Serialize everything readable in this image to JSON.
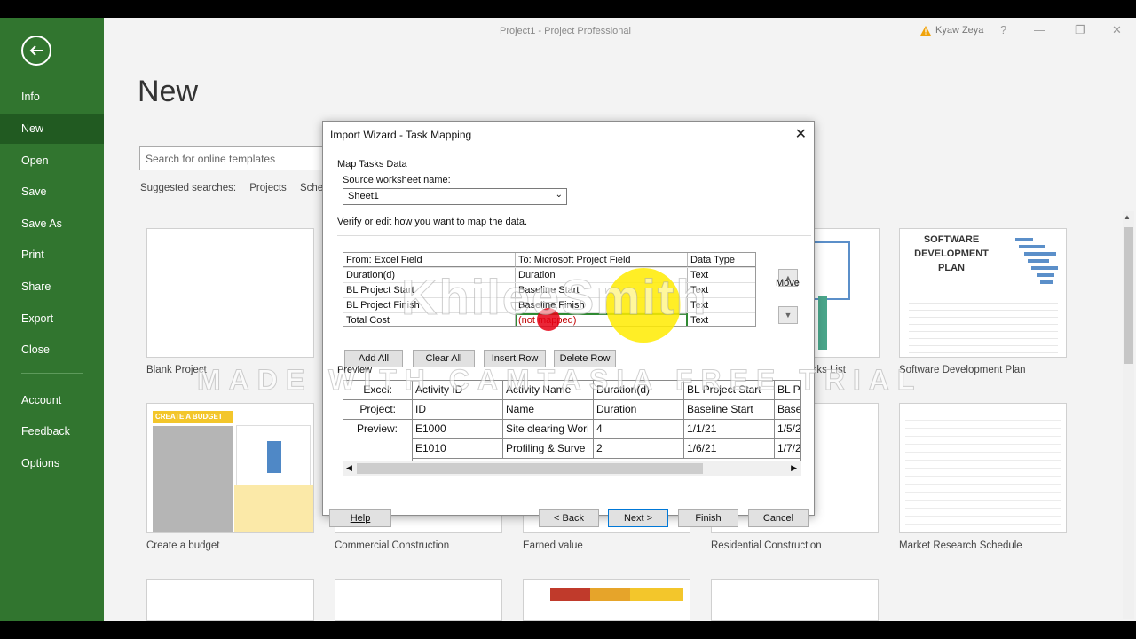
{
  "app": {
    "title": "Project1  -  Project Professional",
    "user": "Kyaw Zeya"
  },
  "sidebar": {
    "items": [
      {
        "label": "Info"
      },
      {
        "label": "New"
      },
      {
        "label": "Open"
      },
      {
        "label": "Save"
      },
      {
        "label": "Save As"
      },
      {
        "label": "Print"
      },
      {
        "label": "Share"
      },
      {
        "label": "Export"
      },
      {
        "label": "Close"
      },
      {
        "label": "Account"
      },
      {
        "label": "Feedback"
      },
      {
        "label": "Options"
      }
    ],
    "active": "New"
  },
  "main": {
    "title": "New",
    "search_placeholder": "Search for online templates",
    "suggested_label": "Suggested searches:",
    "suggested": [
      "Projects",
      "Schedu"
    ],
    "templates": [
      {
        "label": "Blank Project"
      },
      {
        "label": "...sks List"
      },
      {
        "label": "Software Development Plan"
      },
      {
        "label": "Create a budget"
      },
      {
        "label": "Commercial Construction"
      },
      {
        "label": "Earned value"
      },
      {
        "label": "Residential Construction"
      },
      {
        "label": "Market Research Schedule"
      }
    ],
    "budget_thumb_title": "CREATE A BUDGET",
    "sw_thumb_title": "SOFTWARE DEVELOPMENT PLAN"
  },
  "dialog": {
    "title": "Import Wizard - Task Mapping",
    "section": "Map Tasks Data",
    "source_label": "Source worksheet name:",
    "source_value": "Sheet1",
    "verify_text": "Verify or edit how you want to map the data.",
    "mapping": {
      "headers": [
        "From: Excel Field",
        "To:  Microsoft Project Field",
        "Data Type"
      ],
      "rows": [
        [
          "Duration(d)",
          "Duration",
          "Text"
        ],
        [
          "BL Project Start",
          "Baseline Start",
          "Text"
        ],
        [
          "BL Project Finish",
          "Baseline Finish",
          "Text"
        ],
        [
          "Total Cost",
          "(not mapped)",
          "Text"
        ]
      ]
    },
    "move_label": "Move",
    "buttons": {
      "add_all": "Add All",
      "clear_all": "Clear All",
      "insert_row": "Insert Row",
      "delete_row": "Delete Row",
      "help": "Help",
      "back": "< Back",
      "next": "Next >",
      "finish": "Finish",
      "cancel": "Cancel"
    },
    "preview": {
      "label": "Preview",
      "row_labels": [
        "Excel:",
        "Project:",
        "Preview:"
      ],
      "excel": [
        "Activity ID",
        "Activity Name",
        "Duration(d)",
        "BL Project Start",
        "BL Pro"
      ],
      "project": [
        "ID",
        "Name",
        "Duration",
        "Baseline Start",
        "Baseli"
      ],
      "data": [
        [
          "E1000",
          "Site clearing Worl",
          "4",
          "1/1/21",
          "1/5/2"
        ],
        [
          "E1010",
          "Profiling & Surve",
          "2",
          "1/6/21",
          "1/7/2"
        ]
      ]
    }
  },
  "watermark": {
    "name": "KhileeSmith",
    "camtasia": "MADE WITH CAMTASIA FREE TRIAL"
  }
}
